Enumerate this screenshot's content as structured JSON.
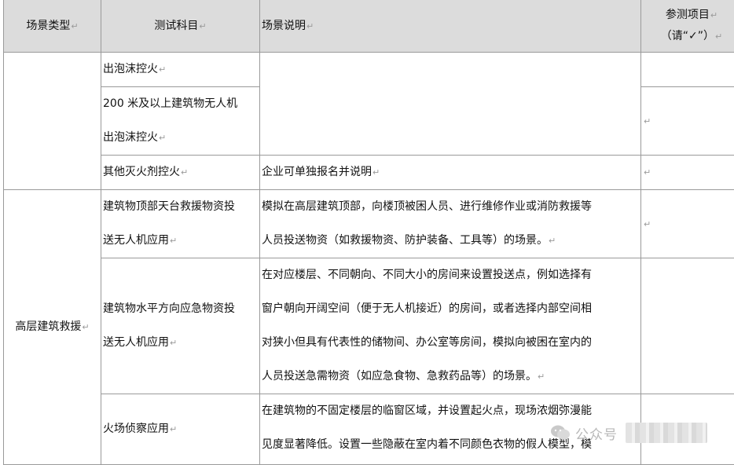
{
  "return_mark": "↵",
  "header": {
    "scene_type": "场景类型",
    "test_subject": "测试科目",
    "scene_desc": "场景说明",
    "ref_line1": "参测项目",
    "ref_line2_pre": "（请“",
    "ref_check": "✓",
    "ref_line2_post": "”）"
  },
  "rows": [
    {
      "subject": "出泡沫控火",
      "desc": ""
    },
    {
      "subject_l1": "200 米及以上建筑物无人机",
      "subject_l2": "出泡沫控火",
      "desc": ""
    },
    {
      "subject": "其他灭火剂控火",
      "desc": "企业可单独报名并说明"
    },
    {
      "subject_l1": "建筑物顶部天台救援物资投",
      "subject_l2": "送无人机应用",
      "desc_l1": "模拟在高层建筑顶部，向楼顶被困人员、进行维修作业或消防救援等",
      "desc_l2": "人员投送物资（如救援物资、防护装备、工具等）的场景。"
    },
    {
      "subject_l1": "建筑物水平方向应急物资投",
      "subject_l2": "送无人机应用",
      "desc_l1": "在对应楼层、不同朝向、不同大小的房间来设置投送点，例如选择有",
      "desc_l2": "窗户朝向开阔空间（便于无人机接近）的房间，或者选择内部空间相",
      "desc_l3": "对狭小但具有代表性的储物间、办公室等房间，模拟向被困在室内的",
      "desc_l4": "人员投送急需物资（如应急食物、急救药品等）的场景。"
    },
    {
      "subject": "火场侦察应用",
      "desc_l1": "在建筑物的不固定楼层的临窗区域，并设置起火点，现场浓烟弥漫能",
      "desc_l2": "见度显著降低。设置一些隐蔽在室内着不同颜色衣物的假人模型，模"
    }
  ],
  "scene_group": "高层建筑救援",
  "watermark": {
    "text": "公众号"
  }
}
